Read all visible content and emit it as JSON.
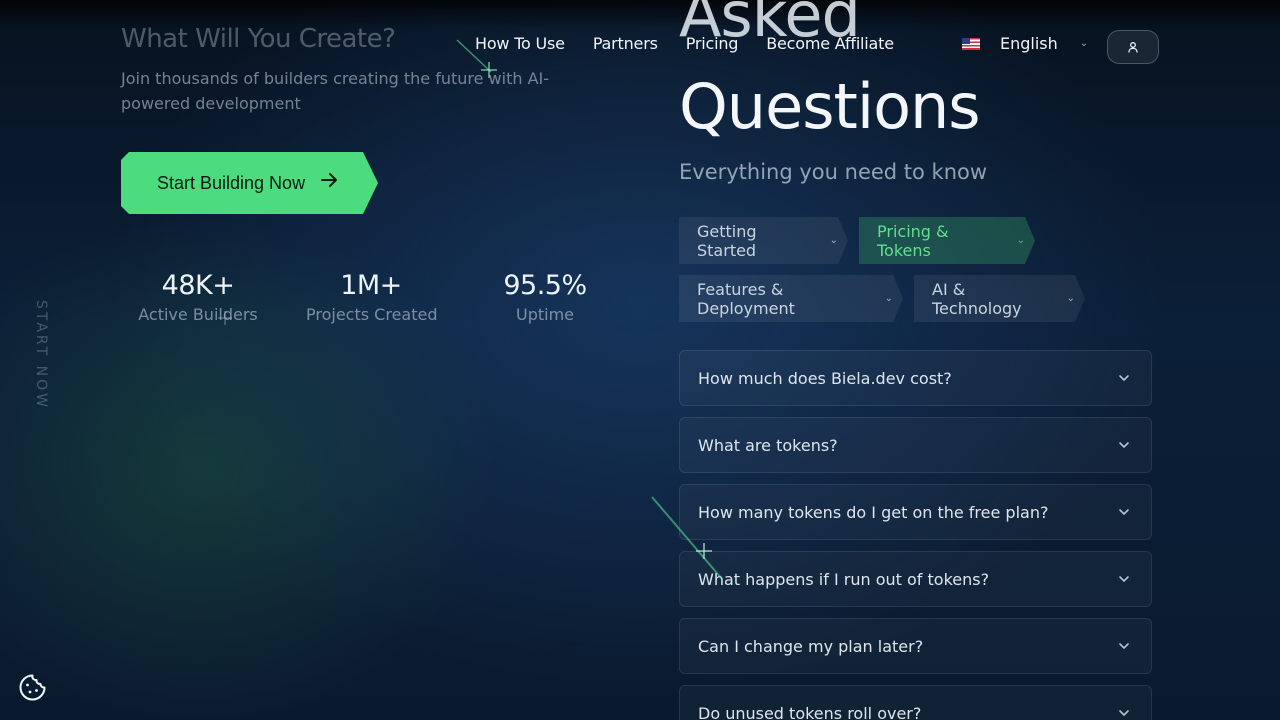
{
  "header": {
    "nav": [
      "How To Use",
      "Partners",
      "Pricing",
      "Become Affiliate"
    ],
    "language": "English",
    "flag_icon": "us-flag-icon"
  },
  "hero": {
    "title": "What Will You Create?",
    "subtitle": "Join thousands of builders creating the future with AI-powered development",
    "cta_label": "Start Building Now",
    "vertical_text": "START NOW",
    "stats": [
      {
        "value": "48K+",
        "label": "Active Builders"
      },
      {
        "value": "1M+",
        "label": "Projects Created"
      },
      {
        "value": "95.5%",
        "label": "Uptime"
      }
    ]
  },
  "faq": {
    "title_top": "Asked",
    "title": "Questions",
    "subtitle": "Everything you need to know",
    "categories": [
      {
        "label": "Getting Started",
        "active": false
      },
      {
        "label": "Pricing & Tokens",
        "active": true
      },
      {
        "label": "Features & Deployment",
        "active": false
      },
      {
        "label": "AI & Technology",
        "active": false
      }
    ],
    "questions": [
      "How much does Biela.dev cost?",
      "What are tokens?",
      "How many tokens do I get on the free plan?",
      "What happens if I run out of tokens?",
      "Can I change my plan later?",
      "Do unused tokens roll over?"
    ]
  },
  "colors": {
    "accent": "#4cdc7e",
    "active_tab_text": "#5fe08d",
    "background": "#0b1f38"
  }
}
